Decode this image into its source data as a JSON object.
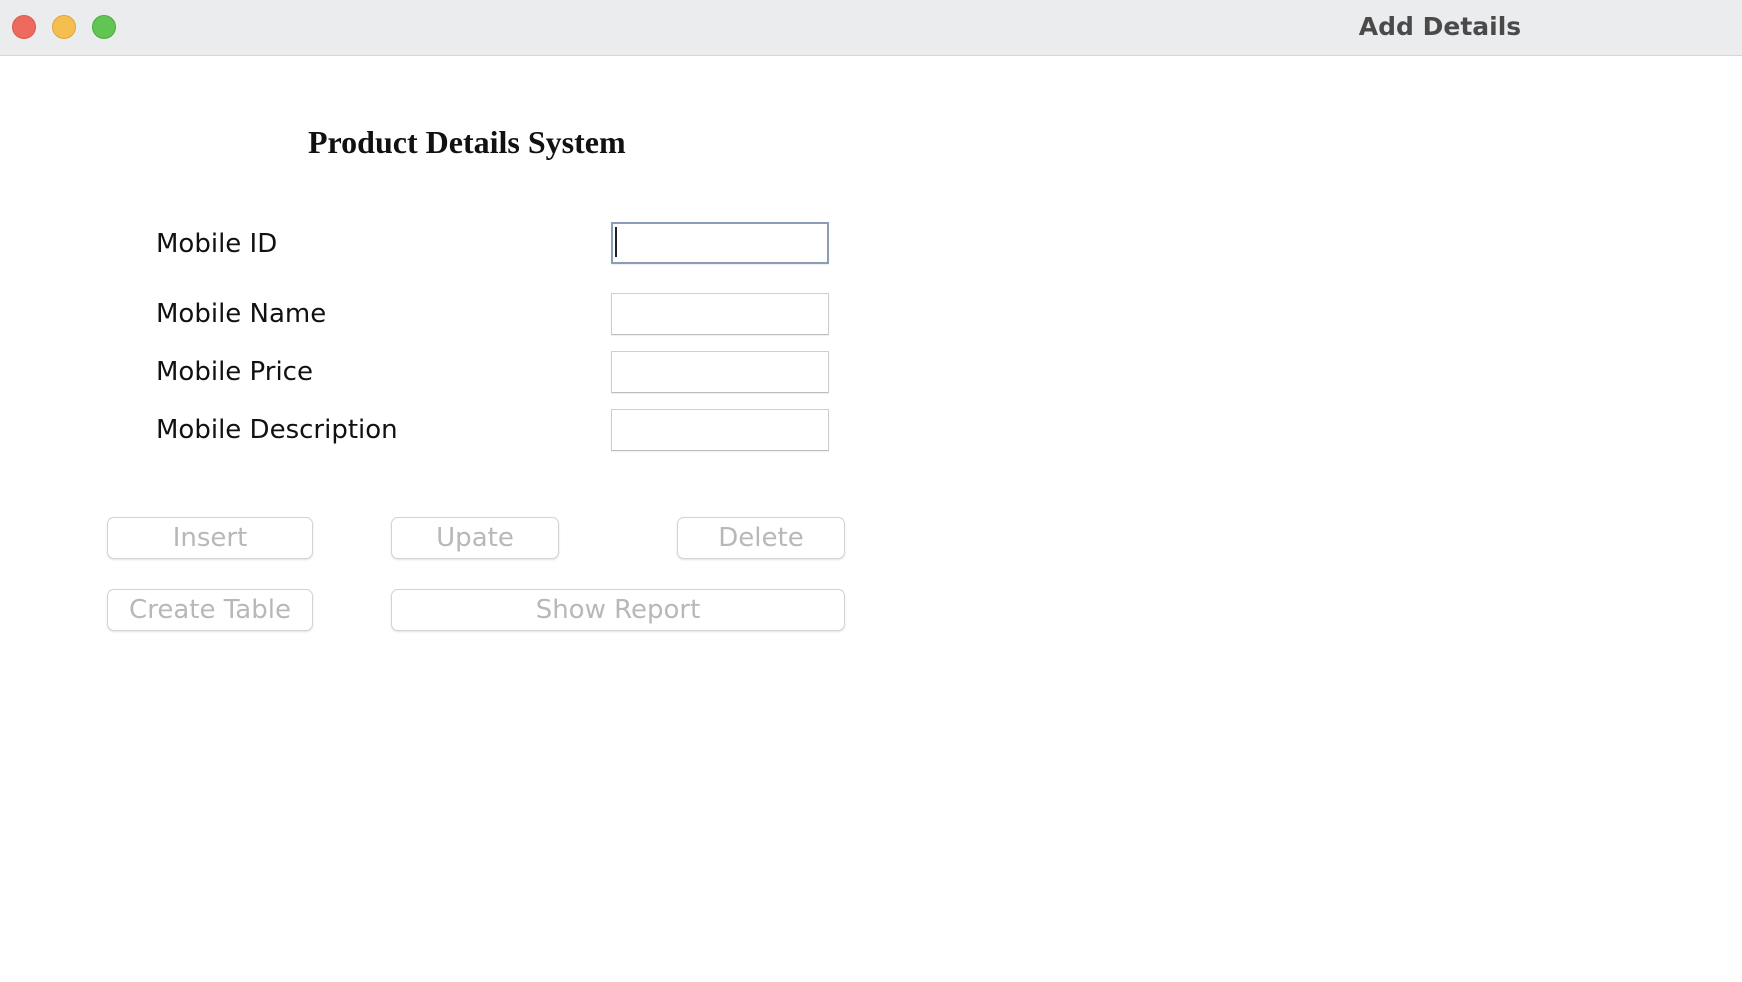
{
  "window": {
    "title": "Add Details",
    "controls": [
      "close",
      "minimize",
      "maximize"
    ]
  },
  "form": {
    "heading": "Product Details System",
    "fields": [
      {
        "label": "Mobile ID",
        "value": "",
        "focused": true
      },
      {
        "label": "Mobile Name",
        "value": ""
      },
      {
        "label": "Mobile Price",
        "value": ""
      },
      {
        "label": "Mobile Description",
        "value": ""
      }
    ]
  },
  "buttons": {
    "insert": "Insert",
    "update": "Upate",
    "delete": "Delete",
    "create_table": "Create Table",
    "show_report": "Show Report"
  },
  "colors": {
    "titlebar": "#ebecee",
    "close": "#ed6a5e",
    "minimize": "#f5bf4f",
    "maximize": "#61c554",
    "button_text_disabled": "#b8b8b8",
    "focus_border": "#8a9db6"
  }
}
